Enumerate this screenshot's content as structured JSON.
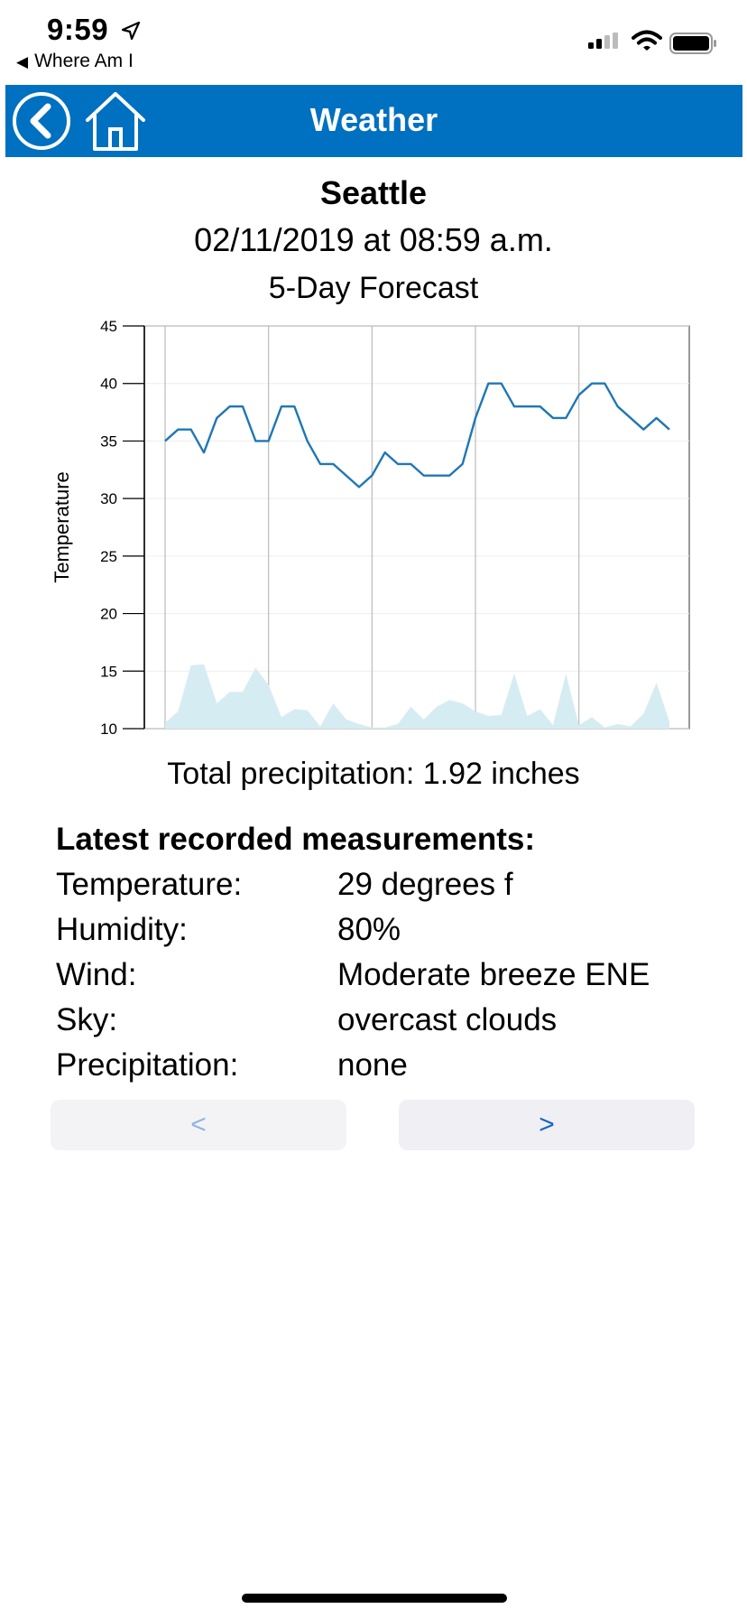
{
  "status_bar": {
    "time": "9:59",
    "back_app": "Where Am I",
    "icons": [
      "location-arrow-icon",
      "cellular-signal-icon",
      "wifi-icon",
      "battery-icon"
    ]
  },
  "nav": {
    "title": "Weather",
    "color": "#0070c0",
    "icons": [
      "back-circle-icon",
      "home-icon"
    ]
  },
  "city": "Seattle",
  "datetime": "02/11/2019 at 08:59 a.m.",
  "forecast_title": "5-Day Forecast",
  "chart_data": {
    "type": "line",
    "ylabel": "Temperature",
    "ylim": [
      10,
      45
    ],
    "yticks": [
      "45",
      "40",
      "35",
      "30",
      "25",
      "20",
      "15",
      "10"
    ],
    "grid": true,
    "series": [
      {
        "values": [
          35,
          36,
          36,
          34,
          37,
          38,
          38,
          35,
          35,
          38,
          38,
          35,
          33,
          33,
          32,
          31,
          32,
          34,
          33,
          33,
          32,
          32,
          32,
          33,
          37,
          40,
          40,
          38,
          38,
          38,
          37,
          37,
          39,
          40,
          40,
          38,
          37,
          36,
          37,
          36
        ],
        "color": "#1f77b4"
      },
      {
        "type": "area",
        "values": [
          10.5,
          11.5,
          15.5,
          15.6,
          12.2,
          13.2,
          13.2,
          15.3,
          13.8,
          11,
          11.7,
          11.6,
          10.2,
          12.2,
          10.8,
          10.4,
          10.1,
          10.1,
          10.4,
          11.9,
          10.8,
          11.9,
          12.5,
          12.2,
          11.5,
          11.1,
          11.2,
          14.8,
          11.1,
          11.7,
          10.3,
          14.8,
          10.3,
          11,
          10.1,
          10.4,
          10.2,
          11.3,
          14,
          10.6
        ],
        "color": "#d6ecf3"
      }
    ]
  },
  "precip_total": "Total precipitation: 1.92 inches",
  "measurements": {
    "heading": "Latest recorded measurements:",
    "rows": [
      {
        "label": "Temperature:",
        "value": "29 degrees f"
      },
      {
        "label": "Humidity:",
        "value": "80%"
      },
      {
        "label": "Wind:",
        "value": "Moderate breeze ENE"
      },
      {
        "label": "Sky:",
        "value": "overcast clouds"
      },
      {
        "label": "Precipitation:",
        "value": "none"
      }
    ]
  },
  "buttons": {
    "prev": "<",
    "next": ">"
  }
}
